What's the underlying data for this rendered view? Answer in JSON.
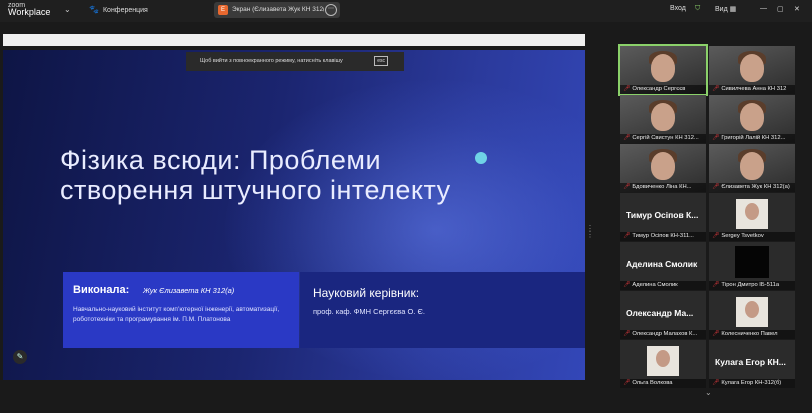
{
  "app": {
    "logo_small": "zoom",
    "logo_big": "Workplace"
  },
  "topbar": {
    "conference_label": "Конференция",
    "share_label": "Экран (Єлизавета Жук КН 312(а))",
    "signin_label": "Вход",
    "view_label": "Вид"
  },
  "banner": {
    "text": "Щоб вийти з повноекранного режиму, натисніть клавішу",
    "key": "esc"
  },
  "slide": {
    "title": "Фізика всюди: Проблеми створення штучного інтелекту",
    "author_heading": "Виконала:",
    "author_name": "Жук Єлизавета КН 312(а)",
    "author_desc": "Навчально-науковий інститут комп’ютерної інженерії, автоматизації, робототехніки та програмування ім. П.М. Платонова",
    "supervisor_heading": "Науковий керівник:",
    "supervisor_name": "проф. каф. ФМН Сергєєва О. Є."
  },
  "participants": [
    {
      "caption": "Олександр Сергєєв",
      "big": "",
      "kind": "video",
      "active": true
    },
    {
      "caption": "Сивилчева Анна КН 312",
      "big": "",
      "kind": "video"
    },
    {
      "caption": "Сергій Свистун КН 312...",
      "big": "",
      "kind": "video"
    },
    {
      "caption": "Григорій Лалій КН 312...",
      "big": "",
      "kind": "video"
    },
    {
      "caption": "Бдовиченко Ліна КН...",
      "big": "",
      "kind": "video"
    },
    {
      "caption": "Єлизавета Жук КН 312(а)",
      "big": "",
      "kind": "video"
    },
    {
      "caption": "Тимур Осіпов КН-311...",
      "big": "Тимур Осіпов К...",
      "kind": "name"
    },
    {
      "caption": "Sergey Tsvetkov",
      "big": "",
      "kind": "photo"
    },
    {
      "caption": "Аделина Смолик",
      "big": "Аделина Смолик",
      "kind": "name"
    },
    {
      "caption": "Тірон Дмитро ІБ-511а",
      "big": "",
      "kind": "black"
    },
    {
      "caption": "Олександр Малахов К...",
      "big": "Олександр Ма...",
      "kind": "name"
    },
    {
      "caption": "Колесниченко Павел",
      "big": "",
      "kind": "photo"
    },
    {
      "caption": "Ольга Волкова",
      "big": "",
      "kind": "photo"
    },
    {
      "caption": "Кулага Егор КН-312(б)",
      "big": "Кулага Егор КН...",
      "kind": "name"
    }
  ]
}
